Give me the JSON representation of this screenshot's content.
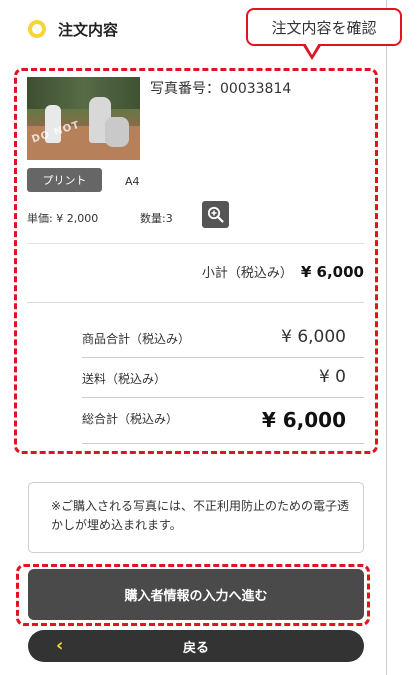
{
  "header": {
    "title": "注文内容"
  },
  "callout": {
    "text": "注文内容を確認"
  },
  "item": {
    "photo_number": "写真番号：00033814",
    "photo_watermark": "DO NOT",
    "print_label": "プリント",
    "size": "A4",
    "unit_price": "単価: ¥ 2,000",
    "quantity": "数量:3",
    "zoom_icon": "zoom-in-icon"
  },
  "subtotal": {
    "label": "小計（税込み）",
    "amount": "¥ 6,000"
  },
  "totals": [
    {
      "label": "商品合計（税込み）",
      "value": "¥ 6,000"
    },
    {
      "label": "送料（税込み）",
      "value": "¥ 0"
    },
    {
      "label": "総合計（税込み）",
      "value": "¥ 6,000"
    }
  ],
  "notice": {
    "text": "※ご購入される写真には、不正利用防止のための電子透かしが埋め込まれます。"
  },
  "buttons": {
    "proceed": "購入者情報の入力へ進む",
    "back": "戻る",
    "back_icon": "chevron-left-icon"
  },
  "colors": {
    "accent_yellow": "#f5d53a",
    "highlight_red": "#e0141e",
    "button_dark": "#4a4a4a"
  }
}
